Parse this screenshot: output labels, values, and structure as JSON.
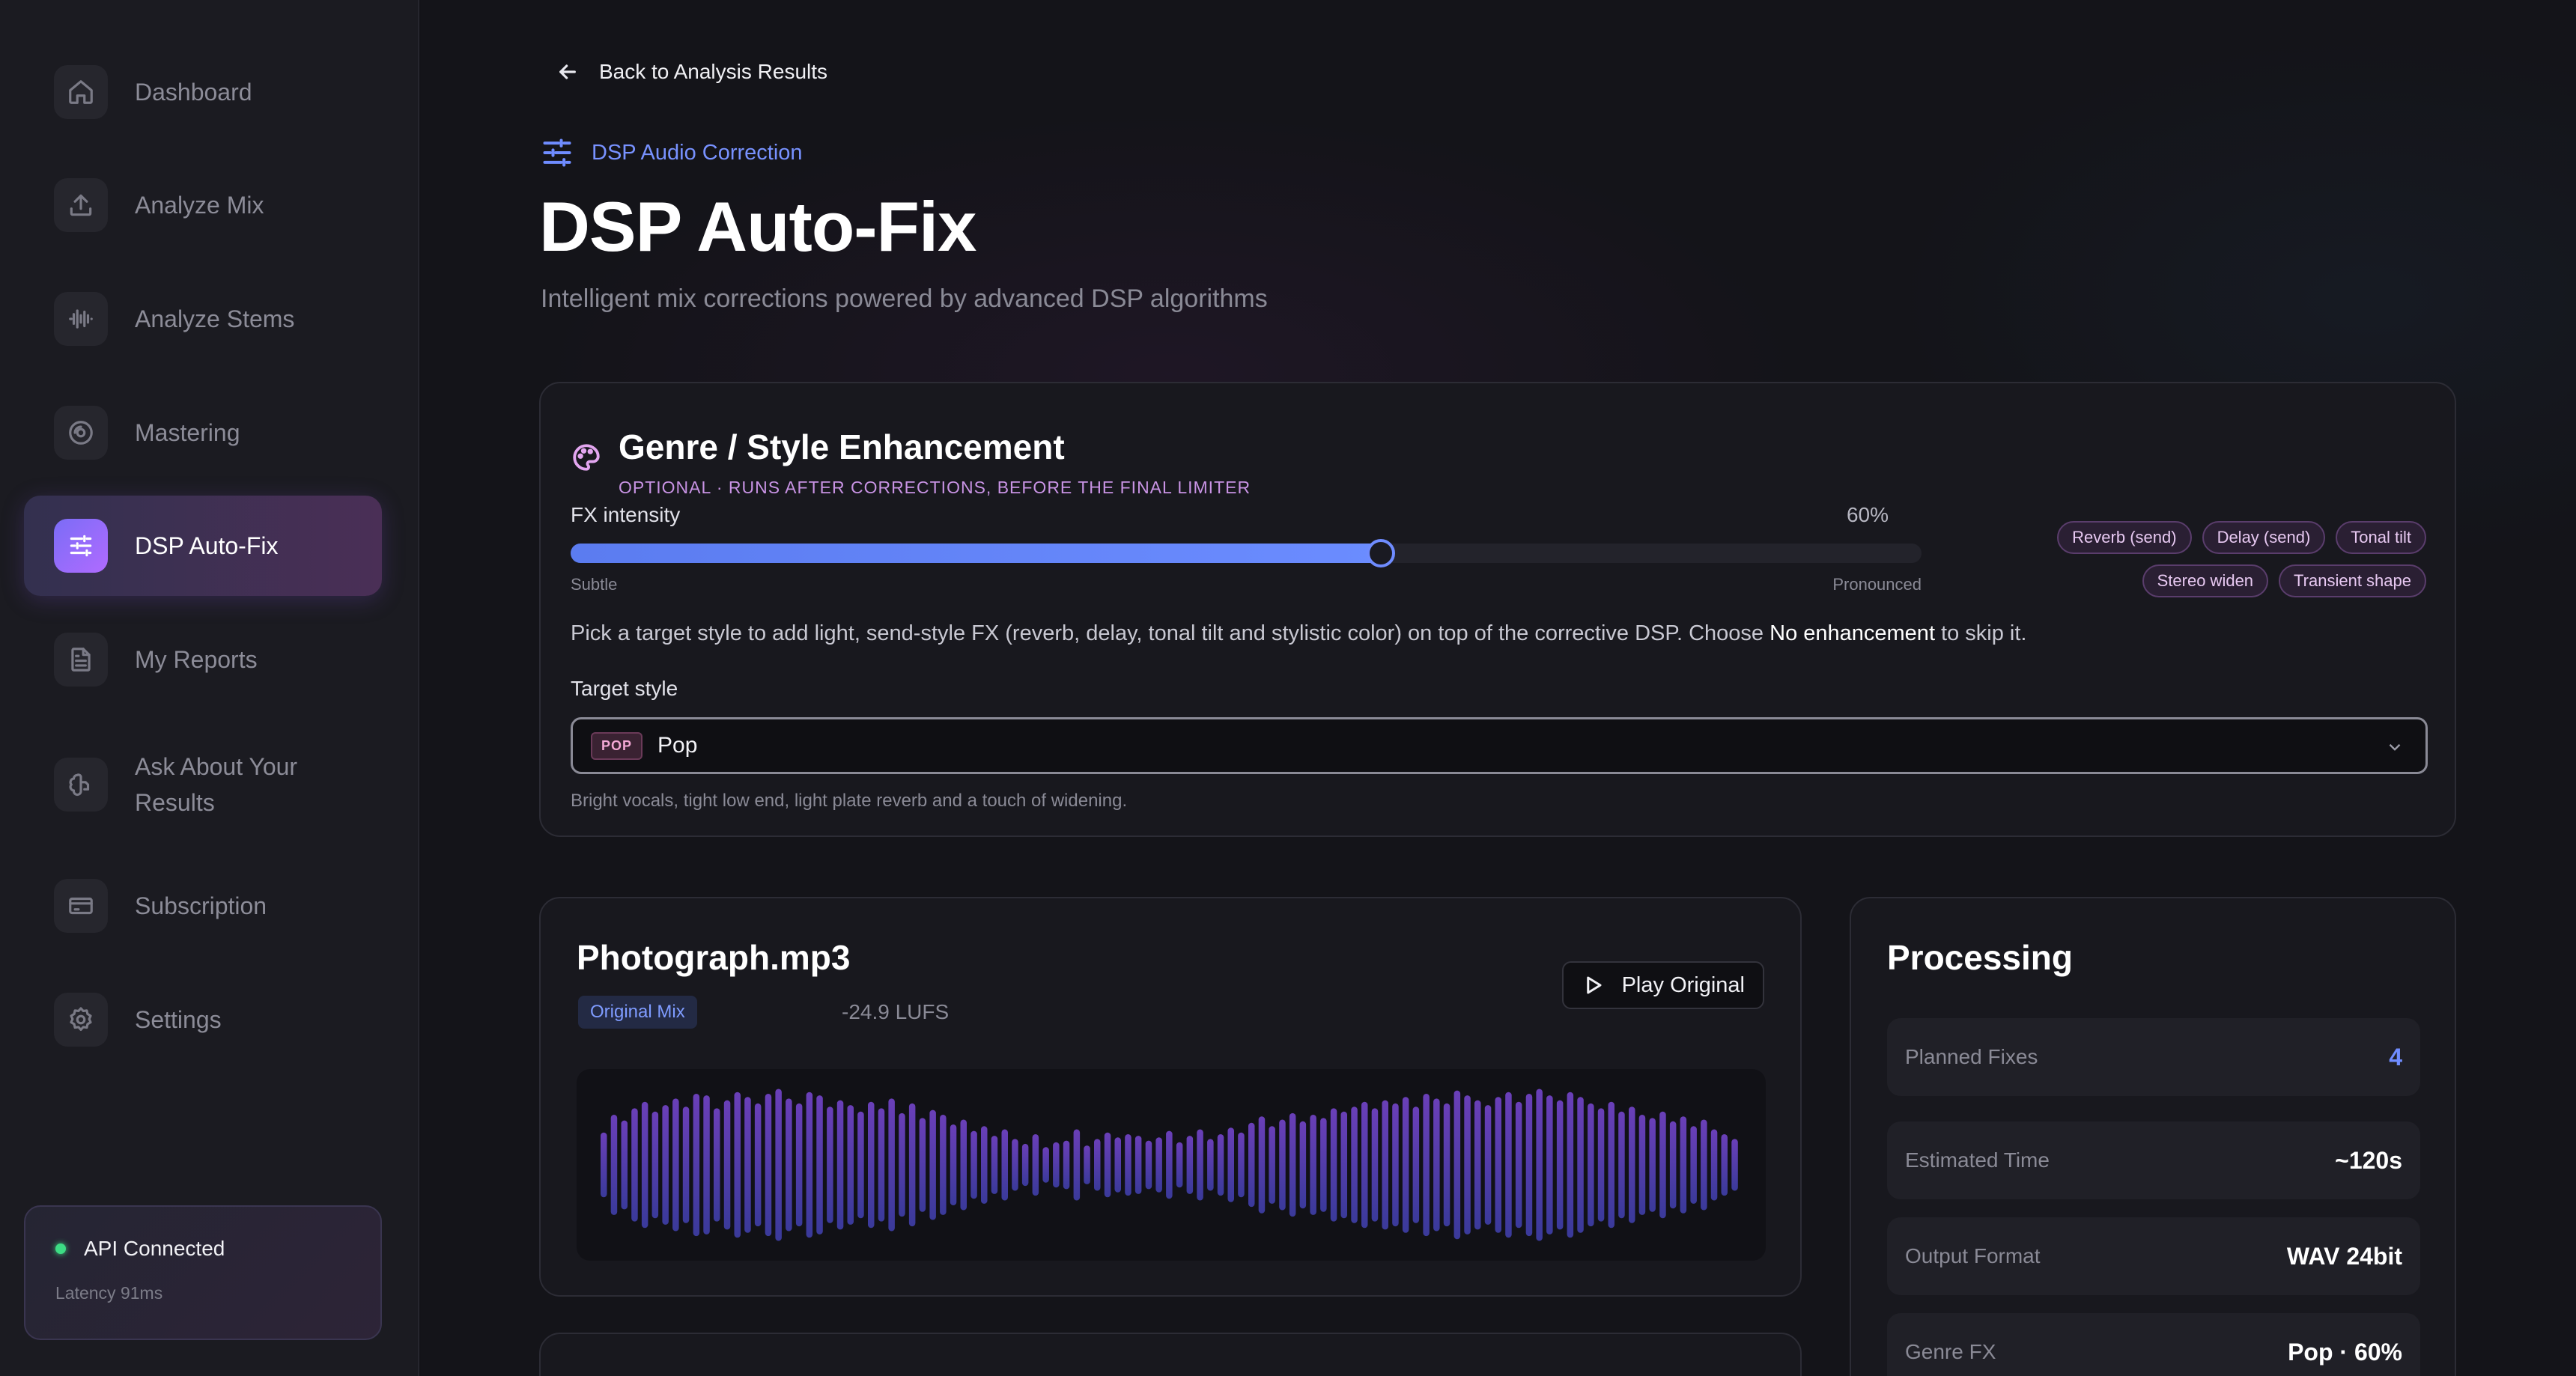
{
  "sidebar": {
    "items": [
      {
        "label": "Dashboard",
        "icon": "home-icon"
      },
      {
        "label": "Analyze Mix",
        "icon": "upload-icon"
      },
      {
        "label": "Analyze Stems",
        "icon": "audio-waveform-icon"
      },
      {
        "label": "Mastering",
        "icon": "disc-icon"
      },
      {
        "label": "DSP Auto-Fix",
        "icon": "sliders-icon",
        "active": true
      },
      {
        "label": "My Reports",
        "icon": "file-text-icon"
      },
      {
        "label": "Ask About Your Results",
        "icon": "brain-icon"
      },
      {
        "label": "Subscription",
        "icon": "credit-card-icon"
      },
      {
        "label": "Settings",
        "icon": "gear-icon"
      }
    ],
    "api": {
      "status": "API Connected",
      "latency": "Latency 91ms",
      "status_color": "#3ddc84"
    }
  },
  "header": {
    "back_label": "Back to Analysis Results",
    "eyebrow": "DSP Audio Correction",
    "title": "DSP Auto-Fix",
    "subtitle": "Intelligent mix corrections powered by advanced DSP algorithms"
  },
  "genre": {
    "title": "Genre / Style Enhancement",
    "eyebrow": "OPTIONAL · RUNS AFTER CORRECTIONS, BEFORE THE FINAL LIMITER",
    "fx_label": "FX intensity",
    "fx_value_label": "60%",
    "fx_value": 0.6,
    "slider_min_label": "Subtle",
    "slider_max_label": "Pronounced",
    "chips": [
      "Reverb (send)",
      "Delay (send)",
      "Tonal tilt",
      "Stereo widen",
      "Transient shape"
    ],
    "desc_before": "Pick a target style to add light, send-style FX (reverb, delay, tonal tilt and stylistic color) on top of the corrective DSP. Choose ",
    "desc_strong": "No enhancement",
    "desc_after": " to skip it.",
    "target_label": "Target style",
    "selected_badge": "POP",
    "selected_value": "Pop",
    "selected_hint": "Bright vocals, tight low end, light plate reverb and a touch of widening."
  },
  "track": {
    "file_name": "Photograph.mp3",
    "tag": "Original Mix",
    "lufs": "-24.9 LUFS",
    "play_label": "Play Original",
    "waveform_levels": [
      0.4,
      0.62,
      0.55,
      0.7,
      0.78,
      0.66,
      0.74,
      0.82,
      0.72,
      0.88,
      0.86,
      0.7,
      0.8,
      0.9,
      0.84,
      0.76,
      0.88,
      0.94,
      0.82,
      0.76,
      0.9,
      0.86,
      0.72,
      0.8,
      0.74,
      0.66,
      0.78,
      0.7,
      0.82,
      0.64,
      0.76,
      0.58,
      0.68,
      0.62,
      0.5,
      0.56,
      0.42,
      0.48,
      0.36,
      0.44,
      0.32,
      0.26,
      0.38,
      0.22,
      0.28,
      0.3,
      0.44,
      0.24,
      0.32,
      0.4,
      0.34,
      0.38,
      0.36,
      0.3,
      0.34,
      0.42,
      0.28,
      0.36,
      0.44,
      0.32,
      0.38,
      0.46,
      0.4,
      0.52,
      0.6,
      0.48,
      0.56,
      0.64,
      0.54,
      0.62,
      0.58,
      0.7,
      0.66,
      0.72,
      0.78,
      0.7,
      0.8,
      0.76,
      0.84,
      0.72,
      0.88,
      0.82,
      0.76,
      0.92,
      0.86,
      0.8,
      0.74,
      0.84,
      0.9,
      0.78,
      0.88,
      0.94,
      0.86,
      0.8,
      0.9,
      0.84,
      0.76,
      0.7,
      0.78,
      0.66,
      0.72,
      0.62,
      0.58,
      0.66,
      0.54,
      0.6,
      0.48,
      0.56,
      0.44,
      0.38,
      0.32
    ]
  },
  "processing": {
    "title": "Processing",
    "rows": [
      {
        "key": "Planned Fixes",
        "value": "4",
        "accent": true
      },
      {
        "key": "Estimated Time",
        "value": "~120s"
      },
      {
        "key": "Output Format",
        "value": "WAV 24bit"
      },
      {
        "key": "Genre FX",
        "value": "Pop · 60%"
      }
    ]
  },
  "colors": {
    "accent": "#6f8cff",
    "genre_accent": "#c893e4",
    "waveform_top": "#6a3fb8",
    "waveform_bottom": "#3a3a9a"
  }
}
